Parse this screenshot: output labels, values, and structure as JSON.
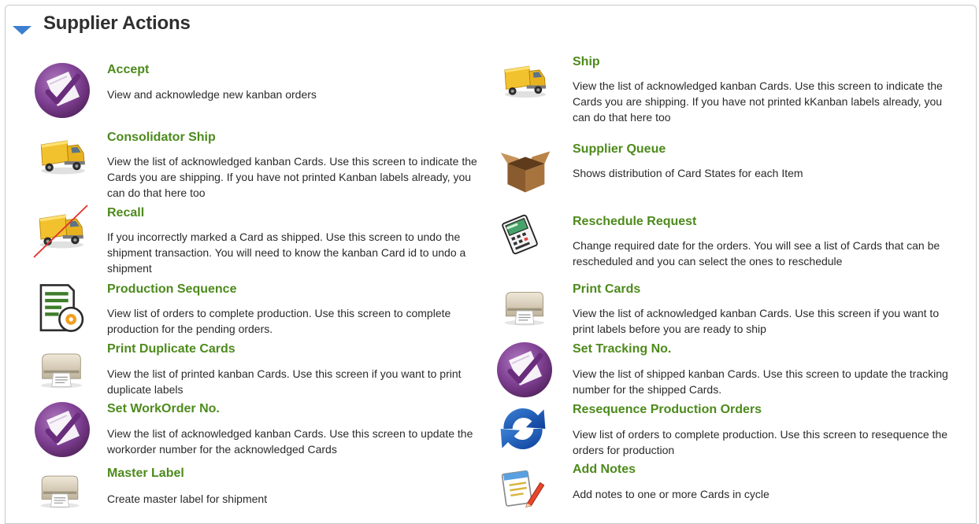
{
  "header": {
    "title": "Supplier Actions"
  },
  "colors": {
    "accent": "#4d8a1c",
    "collapse_arrow": "#3d7fcf"
  },
  "left_items": [
    {
      "label": "Accept",
      "description": "View and acknowledge new kanban orders",
      "icon": "checkmark-badge-icon"
    },
    {
      "label": "Consolidator Ship",
      "description": "View the list of acknowledged kanban Cards. Use this screen to indicate the Cards you are shipping. If you have not printed Kanban labels already, you can do that here too",
      "icon": "truck-icon"
    },
    {
      "label": "Recall",
      "description": "If you incorrectly marked a Card as shipped. Use this screen to undo the shipment transaction. You will need to know the kanban Card id to undo a shipment",
      "icon": "truck-crossed-icon"
    },
    {
      "label": "Production Sequence",
      "description": "View list of orders to complete production. Use this screen to complete production for the pending orders.",
      "icon": "document-gear-icon"
    },
    {
      "label": "Print Duplicate Cards",
      "description": "View the list of printed kanban Cards. Use this screen if you want to print duplicate labels",
      "icon": "printer-icon"
    },
    {
      "label": "Set WorkOrder No.",
      "description": "View the list of acknowledged kanban Cards. Use this screen to update the workorder number for the acknowledged Cards",
      "icon": "checkmark-badge-icon"
    },
    {
      "label": "Master Label",
      "description": "Create master label for shipment",
      "icon": "printer-icon"
    }
  ],
  "right_items": [
    {
      "label": "Ship",
      "description": "View the list of acknowledged kanban Cards. Use this screen to indicate the Cards you are shipping. If you have not printed kKanban labels already, you can do that here too",
      "icon": "truck-icon"
    },
    {
      "label": "Supplier Queue",
      "description": "Shows distribution of Card States for each Item",
      "icon": "box-icon"
    },
    {
      "label": "Reschedule Request",
      "description": "Change required date for the orders. You will see a list of Cards that can be rescheduled and you can select the ones to reschedule",
      "icon": "calendar-device-icon"
    },
    {
      "label": "Print Cards",
      "description": "View the list of acknowledged kanban Cards. Use this screen if you want to print labels before you are ready to ship",
      "icon": "printer-icon"
    },
    {
      "label": "Set Tracking No.",
      "description": "View the list of shipped kanban Cards. Use this screen to update the tracking number for the shipped Cards.",
      "icon": "checkmark-badge-icon"
    },
    {
      "label": "Resequence Production Orders",
      "description": "View list of orders to complete production. Use this screen to resequence the orders for production",
      "icon": "refresh-arrows-icon"
    },
    {
      "label": "Add Notes",
      "description": "Add notes to one or more Cards in cycle",
      "icon": "notes-pencil-icon"
    }
  ]
}
